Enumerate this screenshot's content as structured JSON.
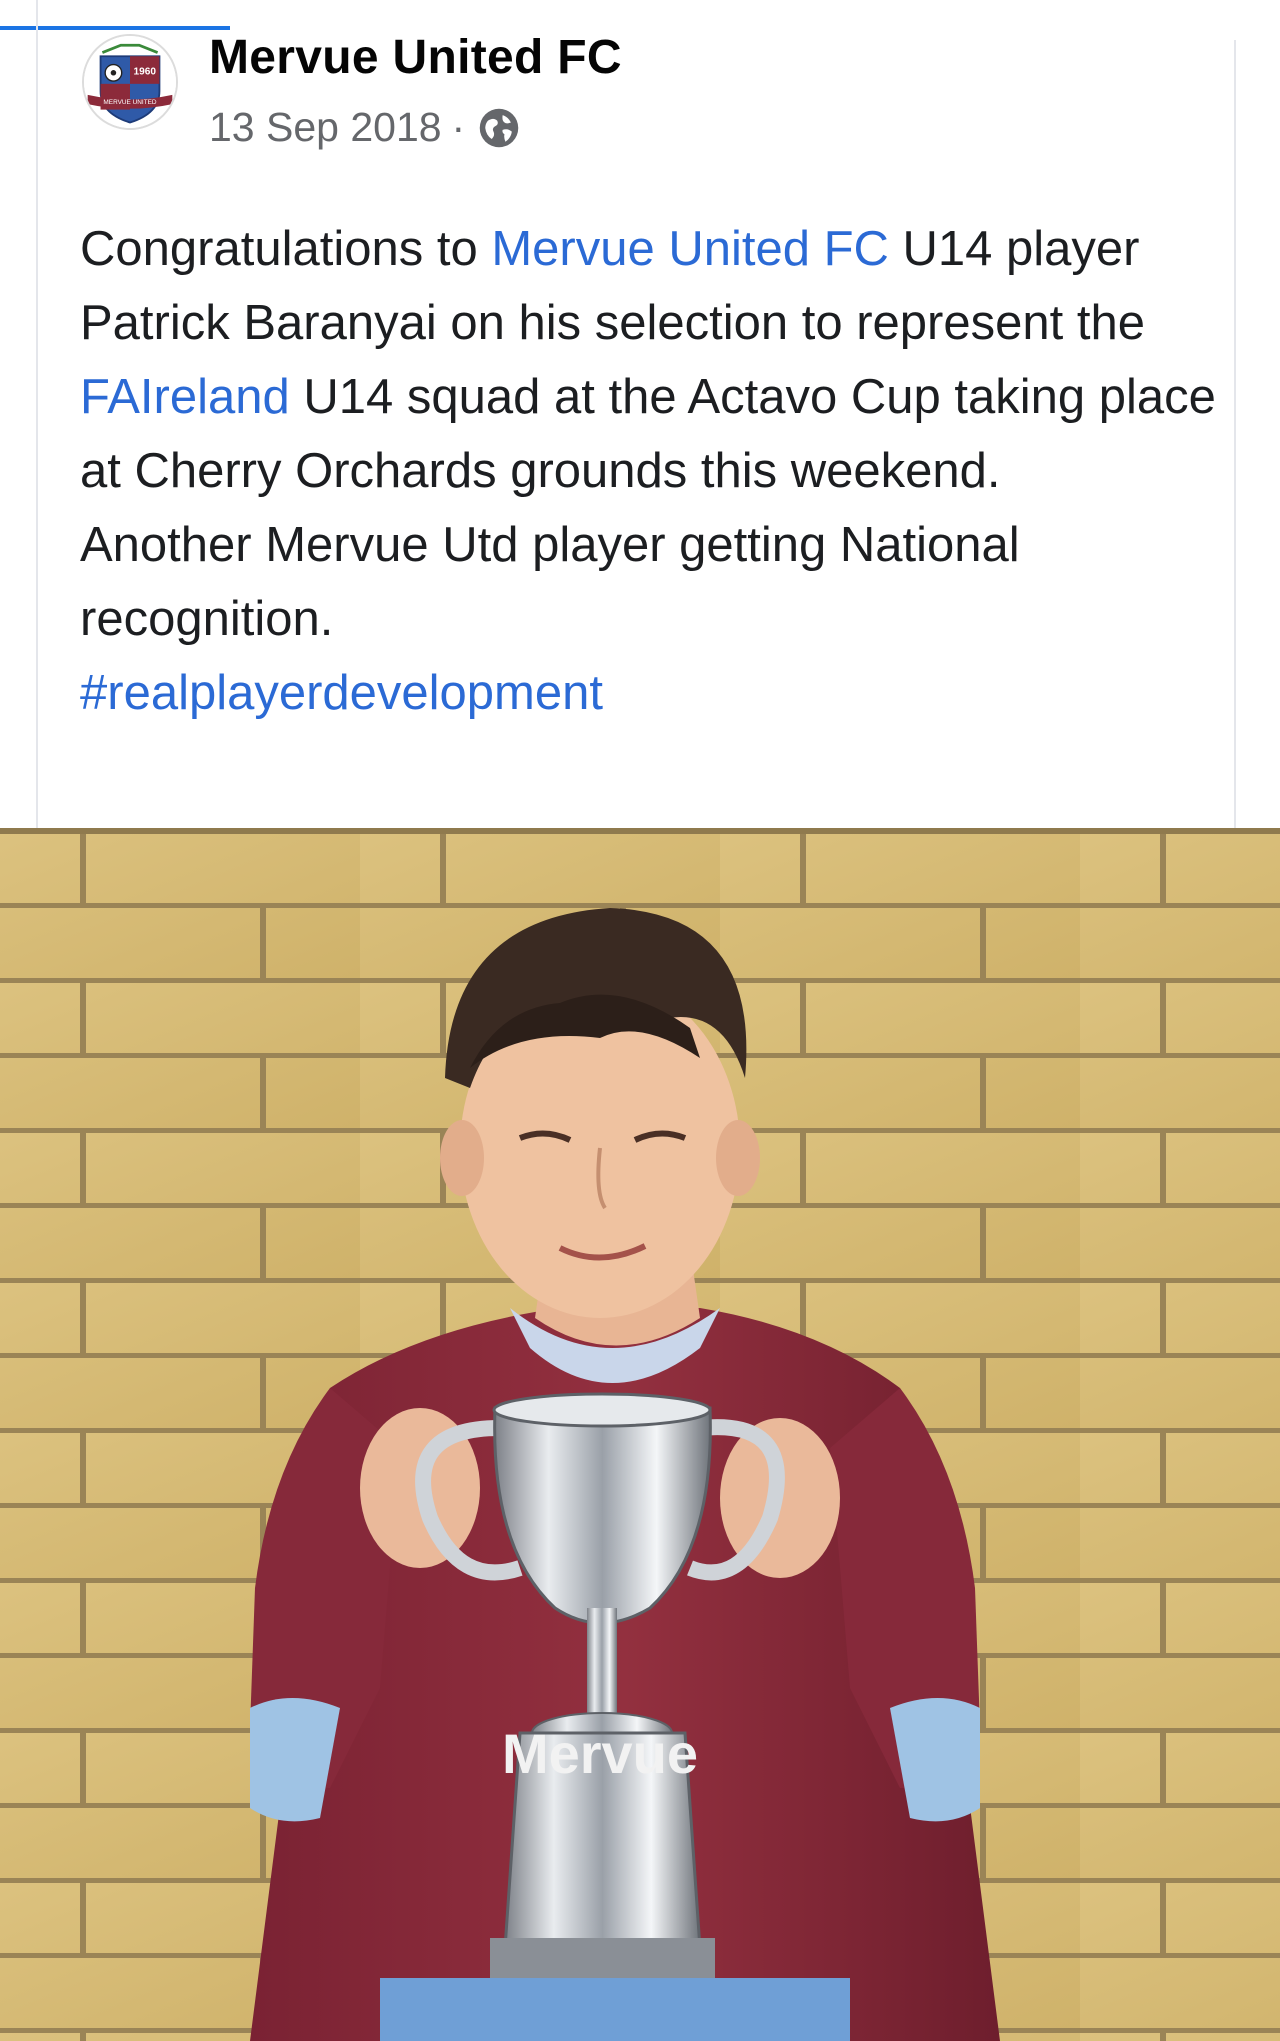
{
  "post": {
    "page_name": "Mervue United FC",
    "date": "13 Sep 2018",
    "separator": "·",
    "privacy_icon": "globe-icon",
    "avatar": {
      "icon": "club-crest-logo",
      "crest_year": "1960",
      "crest_banner": "MERVUE UNITED"
    },
    "text": {
      "p1_pre": "Congratulations to ",
      "p1_link1": "Mervue United FC",
      "p1_mid1": " U14 player Patrick Baranyai on his selection to represent the ",
      "p1_link2": "FAIreland",
      "p1_post": " U14 squad at the Actavo Cup taking place at Cherry Orchards grounds this weekend.",
      "p2": "Another Mervue Utd player getting National recognition.",
      "hashtag": "#realplayerdevelopment"
    },
    "photo": {
      "subject": "boy-holding-trophy-photo",
      "shirt_text": "Mervue"
    }
  },
  "colors": {
    "link": "#2b6ad5",
    "accent": "#1b74e4",
    "text": "#1c1e21",
    "meta": "#65676b",
    "brick": "#d8bd7b",
    "shirt": "#8c2a3a",
    "sleeve": "#9fc3e4"
  }
}
